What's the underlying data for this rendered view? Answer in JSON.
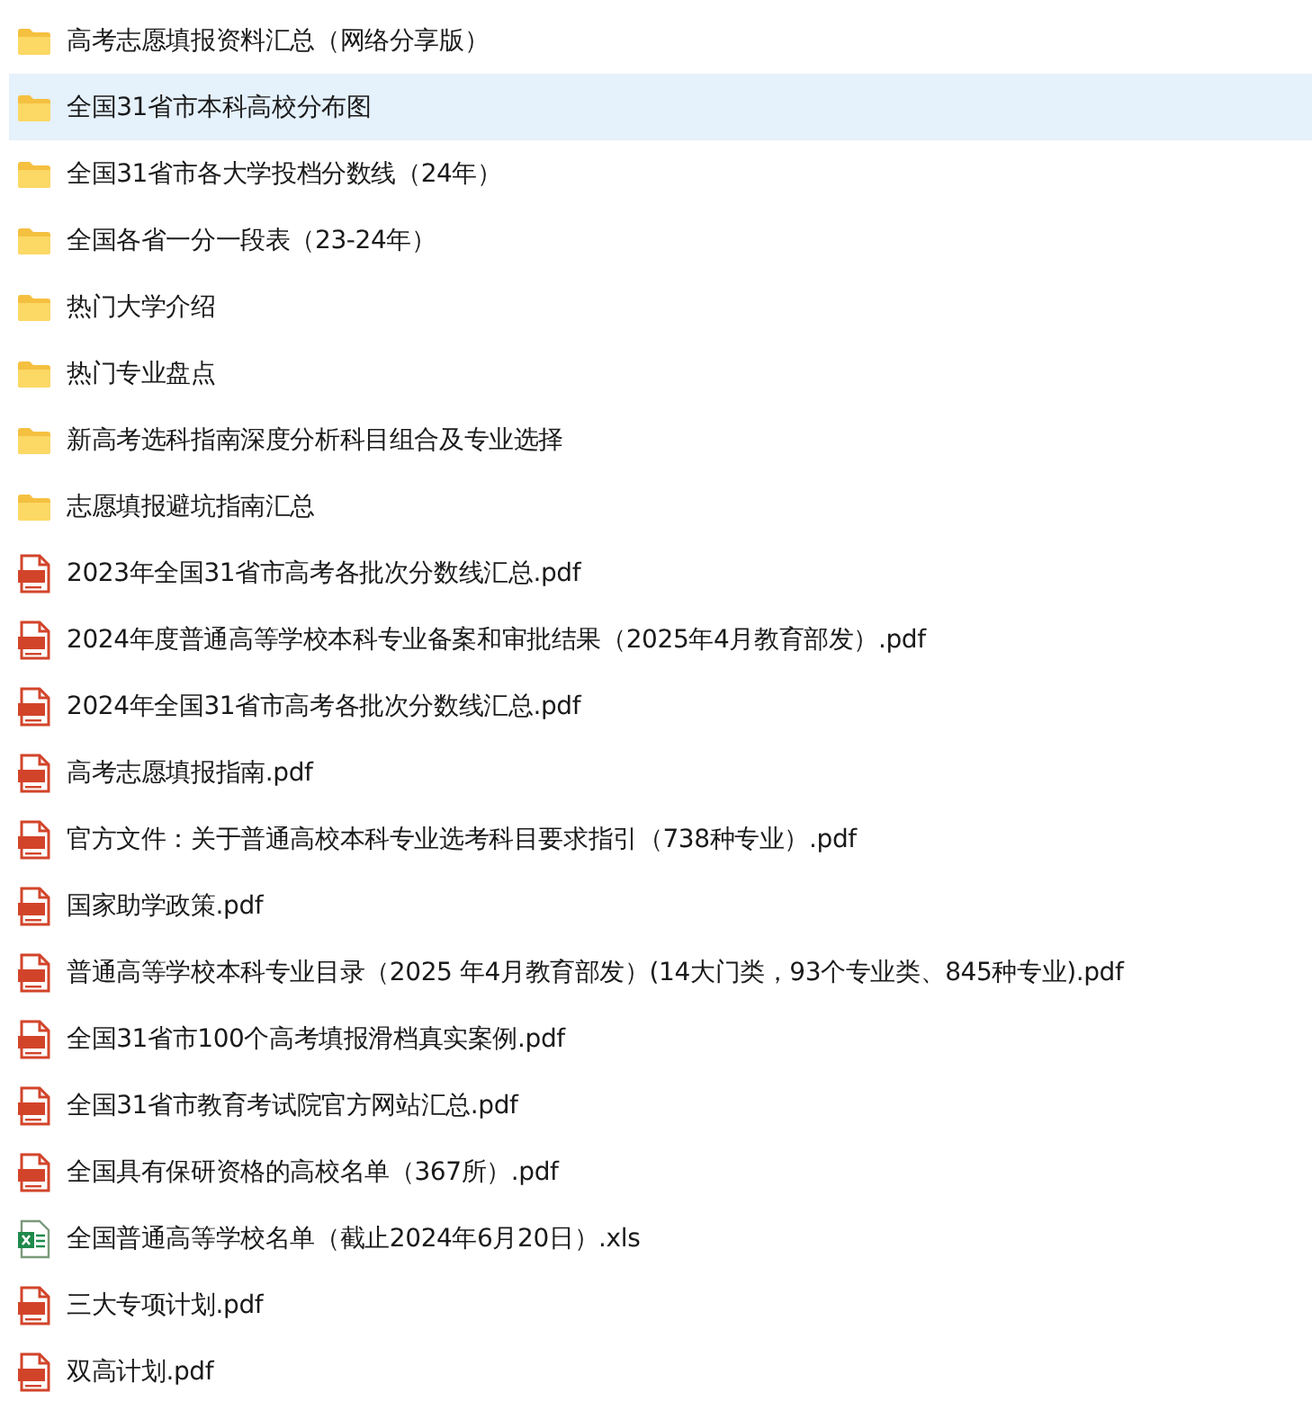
{
  "files": [
    {
      "kind": "folder",
      "name": "高考志愿填报资料汇总（网络分享版）",
      "selected": false
    },
    {
      "kind": "folder",
      "name": "全国31省市本科高校分布图",
      "selected": true
    },
    {
      "kind": "folder",
      "name": "全国31省市各大学投档分数线（24年）",
      "selected": false
    },
    {
      "kind": "folder",
      "name": "全国各省一分一段表（23-24年）",
      "selected": false
    },
    {
      "kind": "folder",
      "name": "热门大学介绍",
      "selected": false
    },
    {
      "kind": "folder",
      "name": "热门专业盘点",
      "selected": false
    },
    {
      "kind": "folder",
      "name": "新高考选科指南深度分析科目组合及专业选择",
      "selected": false
    },
    {
      "kind": "folder",
      "name": "志愿填报避坑指南汇总",
      "selected": false
    },
    {
      "kind": "pdf",
      "name": "2023年全国31省市高考各批次分数线汇总.pdf",
      "selected": false
    },
    {
      "kind": "pdf",
      "name": "2024年度普通高等学校本科专业备案和审批结果（2025年4月教育部发）.pdf",
      "selected": false
    },
    {
      "kind": "pdf",
      "name": "2024年全国31省市高考各批次分数线汇总.pdf",
      "selected": false
    },
    {
      "kind": "pdf",
      "name": "高考志愿填报指南.pdf",
      "selected": false
    },
    {
      "kind": "pdf",
      "name": "官方文件：关于普通高校本科专业选考科目要求指引（738种专业）.pdf",
      "selected": false
    },
    {
      "kind": "pdf",
      "name": "国家助学政策.pdf",
      "selected": false
    },
    {
      "kind": "pdf",
      "name": "普通高等学校本科专业目录（2025 年4月教育部发）(14大门类，93个专业类、845种专业).pdf",
      "selected": false
    },
    {
      "kind": "pdf",
      "name": "全国31省市100个高考填报滑档真实案例.pdf",
      "selected": false
    },
    {
      "kind": "pdf",
      "name": "全国31省市教育考试院官方网站汇总.pdf",
      "selected": false
    },
    {
      "kind": "pdf",
      "name": "全国具有保研资格的高校名单（367所）.pdf",
      "selected": false
    },
    {
      "kind": "xls",
      "name": "全国普通高等学校名单（截止2024年6月20日）.xls",
      "selected": false
    },
    {
      "kind": "pdf",
      "name": "三大专项计划.pdf",
      "selected": false
    },
    {
      "kind": "pdf",
      "name": "双高计划.pdf",
      "selected": false
    }
  ]
}
